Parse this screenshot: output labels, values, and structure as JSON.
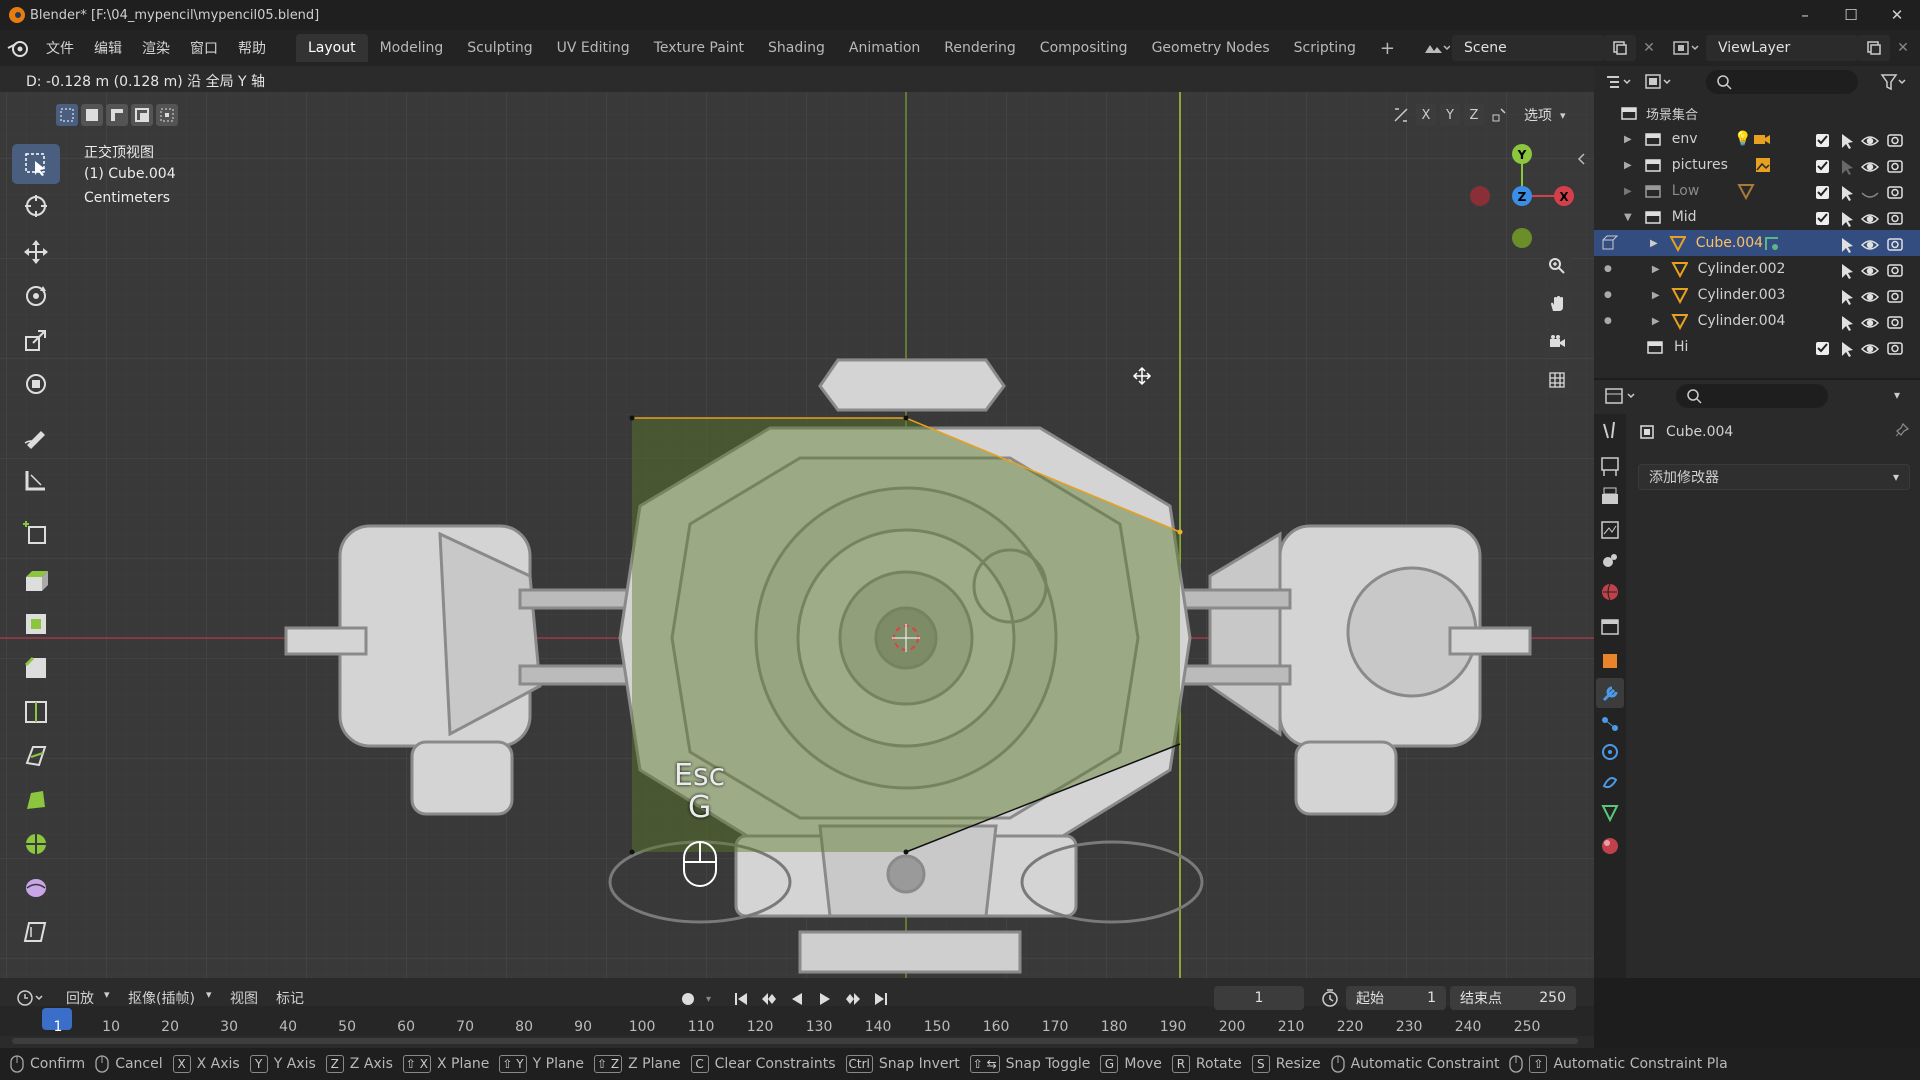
{
  "window": {
    "title": "Blender* [F:\\04_mypencil\\mypencil05.blend]",
    "minimize": "–",
    "maximize": "☐",
    "close": "✕"
  },
  "menu": {
    "file": "文件",
    "edit": "编辑",
    "render": "渲染",
    "window": "窗口",
    "help": "帮助"
  },
  "workspaces": [
    "Layout",
    "Modeling",
    "Sculpting",
    "UV Editing",
    "Texture Paint",
    "Shading",
    "Animation",
    "Rendering",
    "Compositing",
    "Geometry Nodes",
    "Scripting"
  ],
  "workspace_add": "+",
  "active_workspace": "Layout",
  "scene_name": "Scene",
  "view_layer": "ViewLayer",
  "viewport": {
    "status_message": "D: -0.128 m (0.128 m) 沿 全局 Y 轴",
    "view_name": "正交顶视图",
    "object_label": "(1) Cube.004",
    "units": "Centimeters",
    "options_label": "选项",
    "axis_x": "X",
    "axis_y": "Y",
    "axis_z": "Z",
    "key_hint_top": "Esc",
    "key_hint_bottom": "G",
    "accent_colors": {
      "x_axis": "#d43f4c",
      "y_axis": "#8cc63f",
      "z_axis": "#3a8ee6",
      "selection": "#4a5f80"
    }
  },
  "outliner": {
    "root": "场景集合",
    "items": [
      {
        "name": "env",
        "type": "collection"
      },
      {
        "name": "pictures",
        "type": "collection"
      },
      {
        "name": "Low",
        "type": "collection",
        "disabled": true
      },
      {
        "name": "Mid",
        "type": "collection"
      },
      {
        "name": "Cube.004",
        "type": "mesh",
        "selected": true
      },
      {
        "name": "Cylinder.002",
        "type": "mesh"
      },
      {
        "name": "Cylinder.003",
        "type": "mesh"
      },
      {
        "name": "Cylinder.004",
        "type": "mesh"
      },
      {
        "name": "Hi",
        "type": "collection"
      }
    ]
  },
  "properties": {
    "object_name": "Cube.004",
    "add_modifier": "添加修改器"
  },
  "timeline": {
    "playback": "回放",
    "keying": "抠像(插帧)",
    "view": "视图",
    "marker": "标记",
    "current_frame": "1",
    "start_label": "起始",
    "start_value": "1",
    "end_label": "结束点",
    "end_value": "250",
    "ticks": [
      "1",
      "10",
      "20",
      "30",
      "40",
      "50",
      "60",
      "70",
      "80",
      "90",
      "100",
      "110",
      "120",
      "130",
      "140",
      "150",
      "160",
      "170",
      "180",
      "190",
      "200",
      "210",
      "220",
      "230",
      "240",
      "250"
    ]
  },
  "statusbar": [
    {
      "key": "",
      "label": "Confirm",
      "mouse": true
    },
    {
      "key": "",
      "label": "Cancel",
      "mouse": true
    },
    {
      "key": "X",
      "label": "X Axis"
    },
    {
      "key": "Y",
      "label": "Y Axis"
    },
    {
      "key": "Z",
      "label": "Z Axis"
    },
    {
      "key": "⇧ X",
      "label": "X Plane"
    },
    {
      "key": "⇧ Y",
      "label": "Y Plane"
    },
    {
      "key": "⇧ Z",
      "label": "Z Plane"
    },
    {
      "key": "C",
      "label": "Clear Constraints"
    },
    {
      "key": "Ctrl",
      "label": "Snap Invert"
    },
    {
      "key": "⇧ ⇆",
      "label": "Snap Toggle"
    },
    {
      "key": "G",
      "label": "Move"
    },
    {
      "key": "R",
      "label": "Rotate"
    },
    {
      "key": "S",
      "label": "Resize"
    },
    {
      "key": "",
      "label": "Automatic Constraint",
      "mouse": true
    },
    {
      "key": "⇧",
      "label": "Automatic Constraint Pla",
      "mouse": true
    }
  ]
}
